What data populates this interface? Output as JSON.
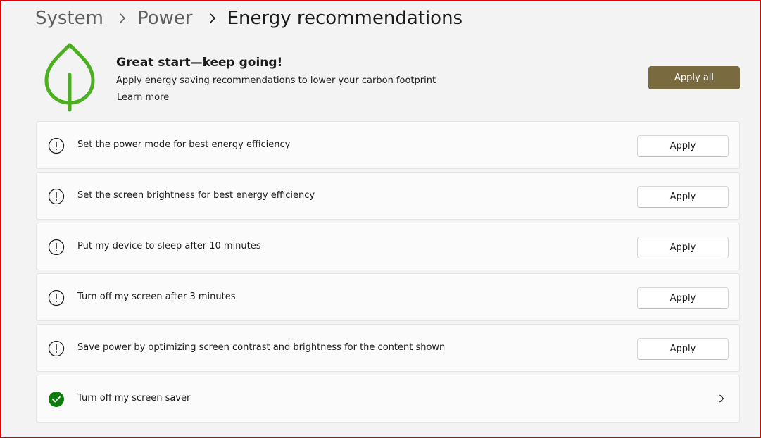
{
  "breadcrumb": {
    "items": [
      {
        "label": "System"
      },
      {
        "label": "Power"
      },
      {
        "label": "Energy recommendations"
      }
    ]
  },
  "hero": {
    "title": "Great start—keep going!",
    "subtitle": "Apply energy saving recommendations to lower your carbon footprint",
    "learn_more": "Learn more",
    "apply_all_label": "Apply all",
    "icon": "leaf-icon"
  },
  "recommendations": [
    {
      "label": "Set the power mode for best energy efficiency",
      "status": "pending",
      "action": "Apply",
      "icon": "alert-circle-icon"
    },
    {
      "label": "Set the screen brightness for best energy efficiency",
      "status": "pending",
      "action": "Apply",
      "icon": "alert-circle-icon"
    },
    {
      "label": "Put my device to sleep after 10 minutes",
      "status": "pending",
      "action": "Apply",
      "icon": "alert-circle-icon"
    },
    {
      "label": "Turn off my screen after 3 minutes",
      "status": "pending",
      "action": "Apply",
      "icon": "alert-circle-icon"
    },
    {
      "label": "Save power by optimizing screen contrast and brightness for the content shown",
      "status": "pending",
      "action": "Apply",
      "icon": "alert-circle-icon"
    },
    {
      "label": "Turn off my screen saver",
      "status": "done",
      "icon": "check-circle-icon"
    }
  ],
  "colors": {
    "accent": "#7a6a3f",
    "leaf": "#4caf1f",
    "success": "#0f7b0f",
    "background": "#f3f3f3",
    "card": "#fbfbfb"
  }
}
